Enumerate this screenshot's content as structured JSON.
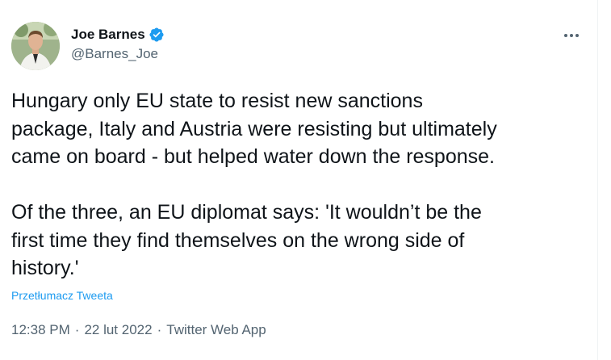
{
  "author": {
    "display_name": "Joe Barnes",
    "handle": "@Barnes_Joe",
    "verified": true
  },
  "tweet": {
    "text": "Hungary only EU state to resist new sanctions\npackage, Italy and Austria were resisting but ultimately\ncame on board - but helped water down the response.\n\nOf the three, an EU diplomat says: 'It wouldn’t be the\nfirst time they find themselves on the wrong side of\nhistory.'",
    "translate_label": "Przetłumacz Tweeta",
    "time": "12:38 PM",
    "date": "22 lut 2022",
    "source": "Twitter Web App",
    "separator": "·"
  },
  "icons": {
    "verified": "verified-badge-icon",
    "more": "more-options-icon"
  },
  "colors": {
    "accent": "#1d9bf0",
    "text_primary": "#0f1419",
    "text_secondary": "#536471"
  }
}
